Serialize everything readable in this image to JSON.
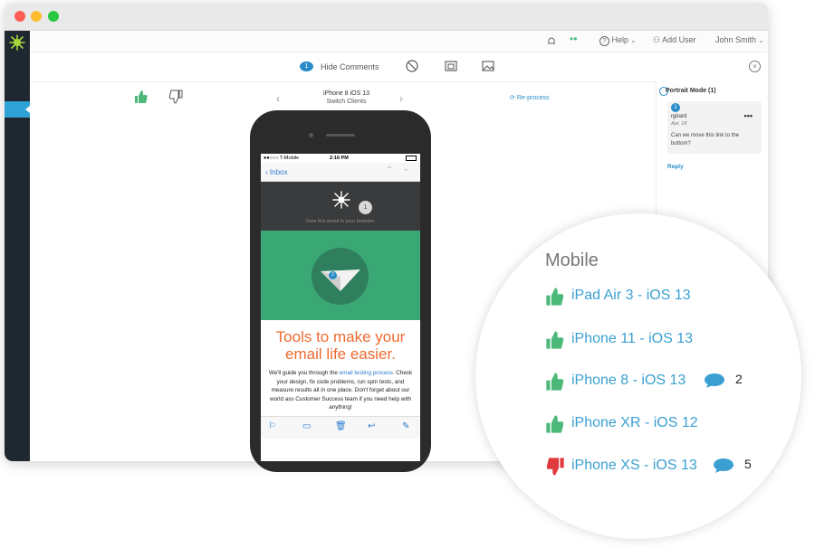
{
  "window": {
    "controls": [
      "close",
      "minimize",
      "maximize"
    ]
  },
  "topbar": {
    "help": "Help",
    "add_user": "Add User",
    "user_name": "John Smith"
  },
  "toolbar": {
    "comment_count": "1",
    "hide_comments": "Hide Comments",
    "icons": [
      "rotate-icon",
      "layout-icon",
      "image-icon",
      "close-icon"
    ]
  },
  "preview": {
    "client_name": "iPhone 8 iOS 13",
    "switch_clients": "Switch Clients",
    "reprocess": "Re-process"
  },
  "comments": {
    "header": "Portrait Mode (1)",
    "items": [
      {
        "number": "1",
        "user": "rgirard",
        "date": "Apr, 18",
        "text": "Can we move this link to the bottom?"
      }
    ],
    "reply": "Reply"
  },
  "email": {
    "carrier": "T-Mobile",
    "time": "2:16 PM",
    "back": "Inbox",
    "view_in_browser": "View this email in your browser.",
    "badge_dark": "1",
    "badge_green": "2",
    "headline": "Tools to make your email life easier.",
    "body_before": "We'll guide you through the ",
    "body_link": "email testing process",
    "body_after": ". Check your design, fix code problems, run spm tests, and measure results all in one place. Don't forget about our world ass Customer Success team if you need help with anything!"
  },
  "mobile_list": {
    "title": "Mobile",
    "items": [
      {
        "label": "iPad Air 3 - iOS 13",
        "status": "approved",
        "comments": ""
      },
      {
        "label": "iPhone 11 - iOS 13",
        "status": "approved",
        "comments": ""
      },
      {
        "label": "iPhone 8 - iOS 13",
        "status": "approved",
        "comments": "2"
      },
      {
        "label": "iPhone XR - iOS 12",
        "status": "approved",
        "comments": ""
      },
      {
        "label": "iPhone XS - iOS 13",
        "status": "rejected",
        "comments": "5"
      }
    ]
  },
  "colors": {
    "approved": "#4cb97a",
    "rejected": "#e0393e",
    "accent": "#2a8cc7",
    "sidebar": "#1f2731"
  }
}
